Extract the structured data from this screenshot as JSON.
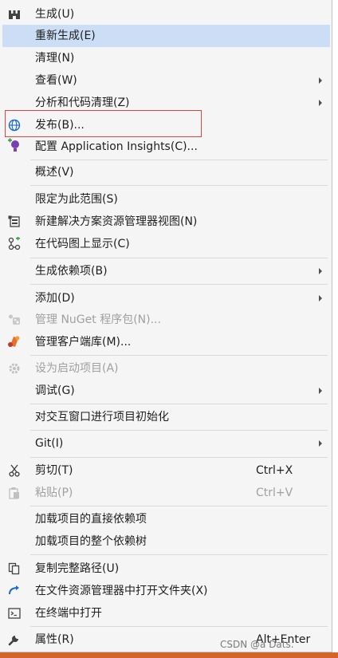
{
  "menu": {
    "items": [
      {
        "label": "生成(U)",
        "icon": "build-icon"
      },
      {
        "label": "重新生成(E)"
      },
      {
        "label": "清理(N)"
      },
      {
        "label": "查看(W)"
      },
      {
        "label": "分析和代码清理(Z)"
      },
      {
        "label": "发布(B)...",
        "icon": "publish-globe-icon"
      },
      {
        "label": "配置 Application Insights(C)...",
        "icon": "application-insights-icon"
      },
      {
        "label": "概述(V)"
      },
      {
        "label": "限定为此范围(S)"
      },
      {
        "label": "新建解决方案资源管理器视图(N)",
        "icon": "new-view-icon"
      },
      {
        "label": "在代码图上显示(C)",
        "icon": "code-map-icon"
      },
      {
        "label": "生成依赖项(B)"
      },
      {
        "label": "添加(D)"
      },
      {
        "label": "管理 NuGet 程序包(N)...",
        "icon": "nuget-icon"
      },
      {
        "label": "管理客户端库(M)...",
        "icon": "client-library-icon"
      },
      {
        "label": "设为启动项目(A)",
        "icon": "gear-icon"
      },
      {
        "label": "调试(G)"
      },
      {
        "label": "对交互窗口进行项目初始化"
      },
      {
        "label": "Git(I)"
      },
      {
        "label": "剪切(T)",
        "shortcut": "Ctrl+X",
        "icon": "scissors-icon"
      },
      {
        "label": "粘贴(P)",
        "shortcut": "Ctrl+V",
        "icon": "paste-icon"
      },
      {
        "label": "加载项目的直接依赖项"
      },
      {
        "label": "加载项目的整个依赖树"
      },
      {
        "label": "复制完整路径(U)",
        "icon": "copy-icon"
      },
      {
        "label": "在文件资源管理器中打开文件夹(X)",
        "icon": "open-folder-arrow-icon"
      },
      {
        "label": "在终端中打开",
        "icon": "terminal-icon"
      },
      {
        "label": "属性(R)",
        "shortcut": "Alt+Enter",
        "icon": "wrench-icon"
      }
    ]
  },
  "watermark": "CSDN @a         Dats.",
  "colors": {
    "highlight": "#ccdef5",
    "annotation_box": "#e04343",
    "disabled_text": "#a0a0a0"
  }
}
